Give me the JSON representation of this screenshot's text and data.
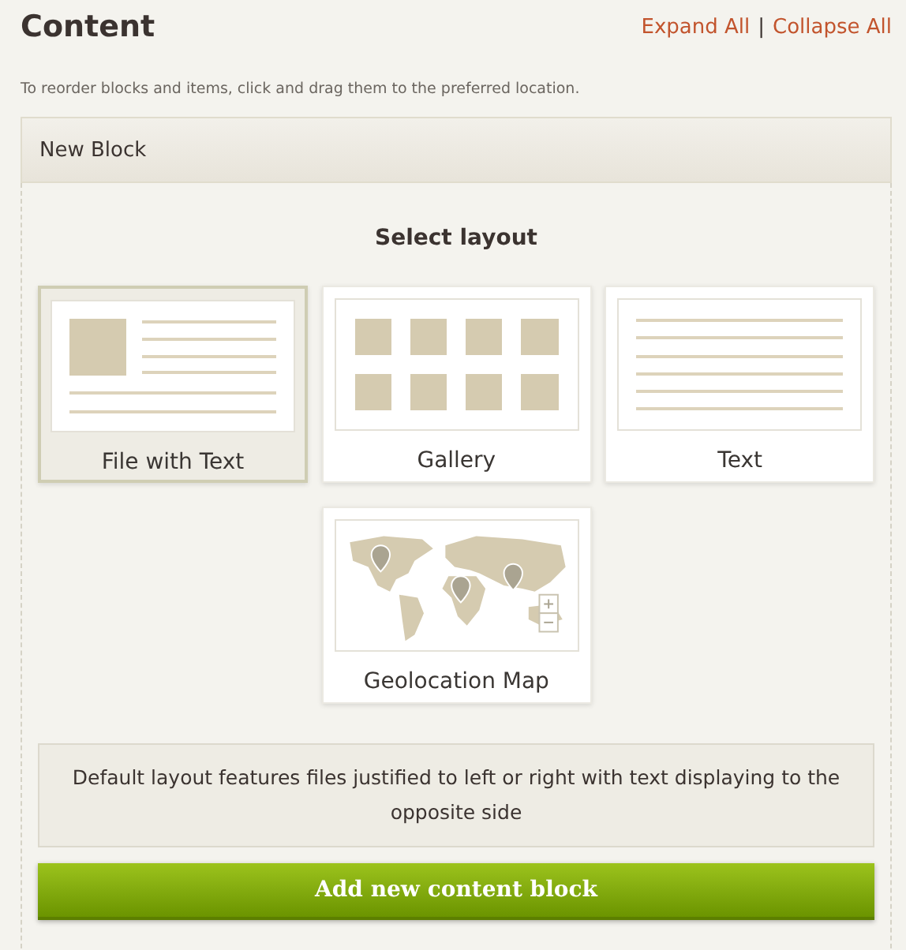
{
  "header": {
    "title": "Content",
    "links": [
      "Expand All",
      "Collapse All"
    ],
    "separator": "|"
  },
  "hint": "To reorder blocks and items, click and drag them to the preferred location.",
  "block": {
    "title": "New Block",
    "section_title": "Select layout",
    "layouts": [
      {
        "kind": "file_text",
        "label": "File with Text",
        "selected": true
      },
      {
        "kind": "gallery",
        "label": "Gallery",
        "selected": false
      },
      {
        "kind": "text",
        "label": "Text",
        "selected": false
      },
      {
        "kind": "map",
        "label": "Geolocation Map",
        "selected": false
      }
    ],
    "description": "Default layout features files justified to left or right with text displaying to the opposite side",
    "button": "Add new content block"
  }
}
